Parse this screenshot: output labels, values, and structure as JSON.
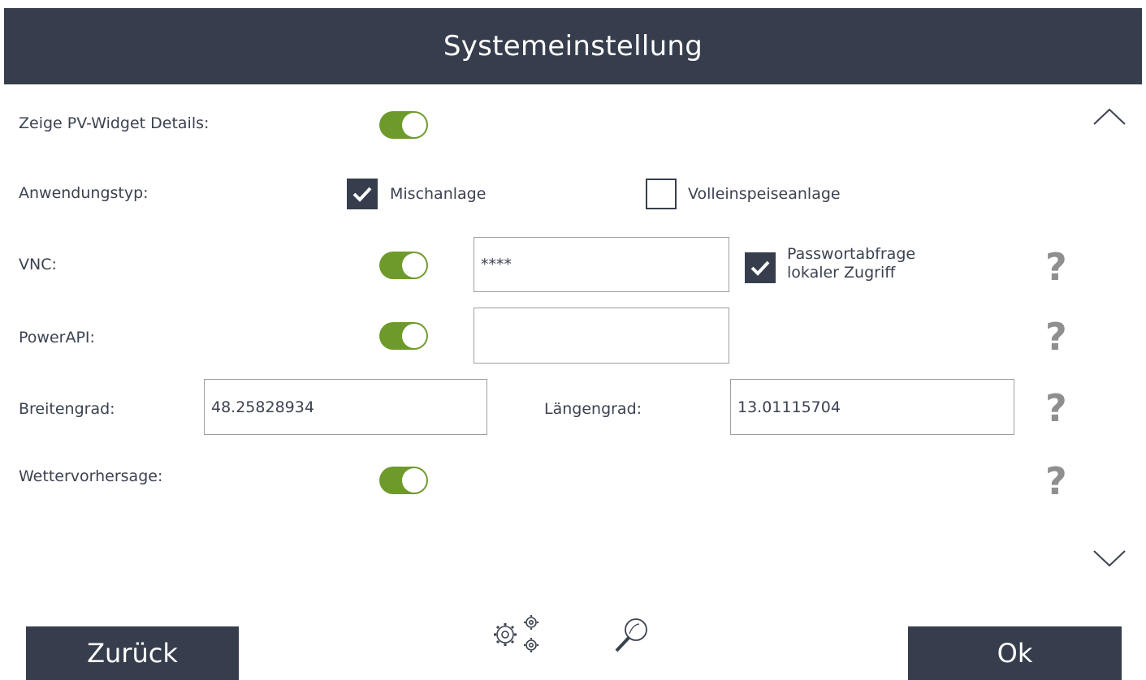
{
  "header": {
    "title": "Systemeinstellung"
  },
  "rows": {
    "pv_widget": {
      "label": "Zeige PV-Widget Details:",
      "enabled": true
    },
    "anwendungstyp": {
      "label": "Anwendungstyp:",
      "options": [
        {
          "label": "Mischanlage",
          "checked": true
        },
        {
          "label": "Volleinspeiseanlage",
          "checked": false
        }
      ]
    },
    "vnc": {
      "label": "VNC:",
      "enabled": true,
      "password_value": "****",
      "password_prompt": {
        "line1": "Passwortabfrage",
        "line2": "lokaler Zugriff",
        "checked": true
      },
      "help": "?"
    },
    "powerapi": {
      "label": "PowerAPI:",
      "enabled": true,
      "value": "",
      "help": "?"
    },
    "coords": {
      "lat_label": "Breitengrad:",
      "lat_value": "48.25828934",
      "lon_label": "Längengrad:",
      "lon_value": "13.01115704",
      "help": "?"
    },
    "weather": {
      "label": "Wettervorhersage:",
      "enabled": true,
      "help": "?"
    }
  },
  "icons": {
    "scroll_up": "chevron-up-icon",
    "scroll_down": "chevron-down-icon",
    "settings": "gears-icon",
    "search": "magnifier-icon"
  },
  "footer": {
    "back_label": "Zurück",
    "ok_label": "Ok"
  },
  "colors": {
    "header_bg": "#363e4d",
    "toggle_on": "#6e9a2c",
    "help": "#8f8f8f"
  }
}
